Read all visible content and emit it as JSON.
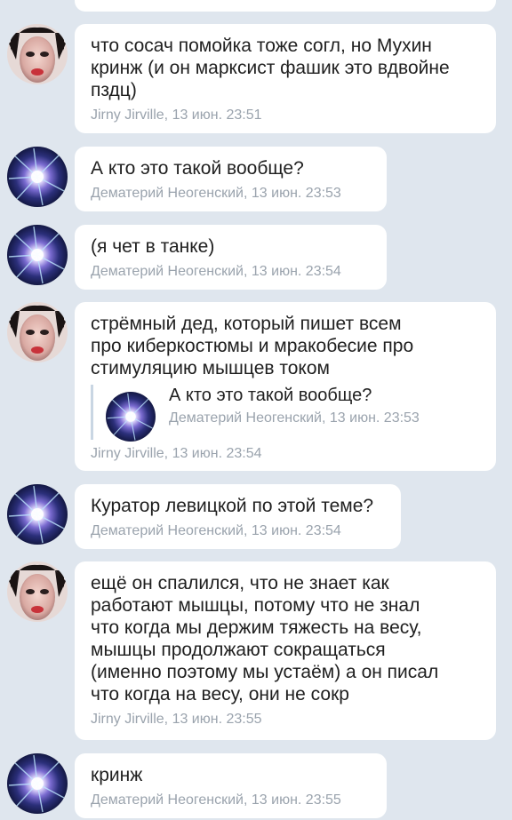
{
  "messages": [
    {
      "author": "jirny",
      "text": "что сосач помойка тоже согл, но Мухин\nкринж (и он марксист фашик это вдвойне\nпздц)",
      "meta": "Jirny Jirville, 13 июн. 23:51"
    },
    {
      "author": "dem",
      "text": "А кто это такой вообще?",
      "meta": "Дематерий Неогенский, 13 июн. 23:53"
    },
    {
      "author": "dem",
      "text": "(я чет в танке)",
      "meta": "Дематерий Неогенский, 13 июн. 23:54"
    },
    {
      "author": "jirny",
      "text": "стрёмный дед, который пишет всем\nпро киберкостюмы и мракобесие про\nстимуляцию мышцев током",
      "reply": {
        "text": "А кто это такой вообще?",
        "meta": "Дематерий Неогенский, 13 июн. 23:53"
      },
      "meta": "Jirny Jirville, 13 июн. 23:54"
    },
    {
      "author": "dem",
      "text": "Куратор левицкой по этой теме?",
      "meta": "Дематерий Неогенский, 13 июн. 23:54"
    },
    {
      "author": "jirny",
      "text": "ещё он спалился, что не знает как\nработают мышцы, потому что не знал\nчто когда мы держим тяжесть на весу,\nмышцы продолжают сокращаться\n(именно поэтому мы устаём) а он писал\nчто когда на весу, они не сокр",
      "meta": "Jirny Jirville, 13 июн. 23:55"
    },
    {
      "author": "dem",
      "text": "кринж",
      "meta": "Дематерий Неогенский, 13 июн. 23:55"
    }
  ],
  "colors": {
    "background": "#dfe6ee",
    "bubble": "#ffffff",
    "meta_text": "#9aa3ad",
    "reply_bar": "#c9d6e3"
  }
}
